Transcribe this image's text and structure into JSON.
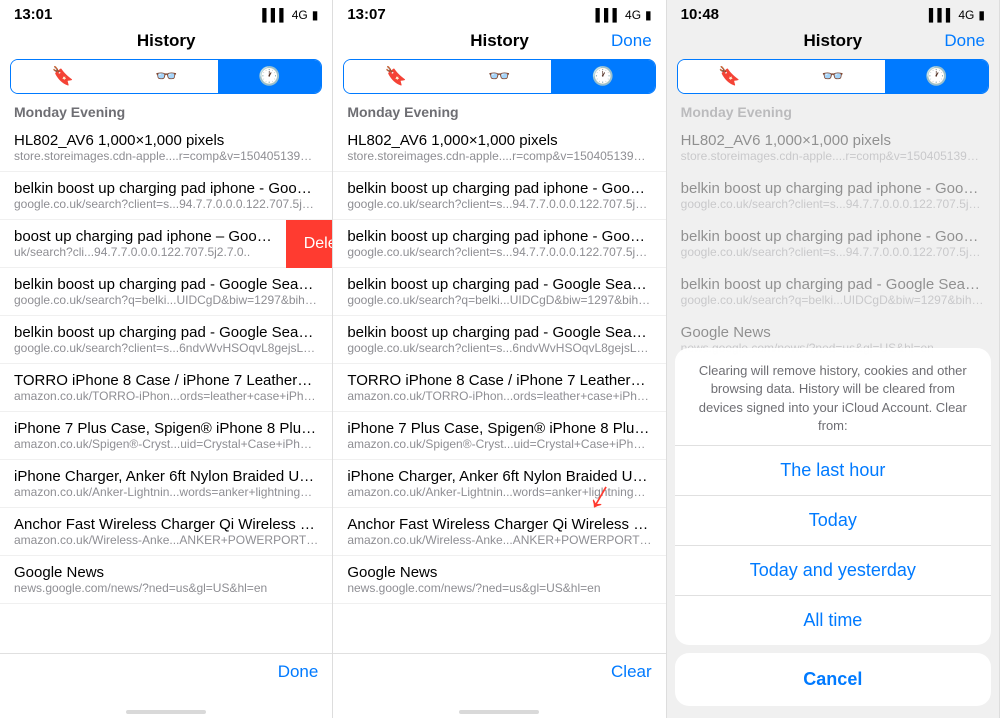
{
  "panel1": {
    "statusTime": "13:01",
    "statusSignal": "▌▌▌ 4G ▮",
    "title": "History",
    "doneLabel": "",
    "tabs": [
      {
        "icon": "🔖",
        "active": false
      },
      {
        "icon": "👓",
        "active": false
      },
      {
        "icon": "🕐",
        "active": true
      }
    ],
    "sectionHeader": "Monday Evening",
    "items": [
      {
        "title": "HL802_AV6 1,000×1,000 pixels",
        "url": "store.storeimages.cdn-apple....r=comp&v=1504051392224"
      },
      {
        "title": "belkin boost up charging pad iphone - Goo…",
        "url": "google.co.uk/search?client=s...94.7.7.0.0.0.122.707.5j2.7.0.."
      },
      {
        "title": "boost up charging pad iphone – Goo…",
        "url": "uk/search?cli...94.7.7.0.0.0.122.707.5j2.7.0.."
      },
      {
        "title": "belkin boost up charging pad - Google Sea…",
        "url": "google.co.uk/search?q=belki...UIDCgD&biw=1297&bih=1355"
      },
      {
        "title": "belkin boost up charging pad - Google Sea…",
        "url": "google.co.uk/search?client=s...6ndvWvHSOqvL8gejsL6oCQ"
      },
      {
        "title": "TORRO iPhone 8 Case / iPhone 7 Leather…",
        "url": "amazon.co.uk/TORRO-iPhon...ords=leather+case+iPhone+8"
      },
      {
        "title": "iPhone 7 Plus Case, Spigen® iPhone 8 Plus…",
        "url": "amazon.co.uk/Spigen®-Cryst...uid=Crystal+Case+iPhone+8"
      },
      {
        "title": "iPhone Charger, Anker 6ft Nylon Braided U…",
        "url": "amazon.co.uk/Anker-Lightnin...words=anker+lightning+cable"
      },
      {
        "title": "Anchor Fast Wireless Charger Qi Wireless I…",
        "url": "amazon.co.uk/Wireless-Anke...ANKER+POWERPORT+QI+10"
      },
      {
        "title": "Google News",
        "url": "news.google.com/news/?ned=us&gl=US&hl=en"
      }
    ],
    "swipeItemIndex": 2,
    "deleteLabel": "Delete",
    "bottomLabel": "Done"
  },
  "panel2": {
    "statusTime": "13:07",
    "statusSignal": "▌▌▌ 4G ▮",
    "title": "History",
    "doneLabel": "Done",
    "tabs": [
      {
        "icon": "🔖",
        "active": false
      },
      {
        "icon": "👓",
        "active": false
      },
      {
        "icon": "🕐",
        "active": true
      }
    ],
    "sectionHeader": "Monday Evening",
    "items": [
      {
        "title": "HL802_AV6 1,000×1,000 pixels",
        "url": "store.storeimages.cdn-apple....r=comp&v=1504051392224"
      },
      {
        "title": "belkin boost up charging pad iphone - Goo…",
        "url": "google.co.uk/search?client=s...94.7.7.0.0.0.122.707.5j2.7.0.."
      },
      {
        "title": "belkin boost up charging pad iphone - Goo…",
        "url": "google.co.uk/search?client=s...94.7.7.0.0.0.122.707.5j2.7.0.."
      },
      {
        "title": "belkin boost up charging pad - Google Sea…",
        "url": "google.co.uk/search?q=belki...UIDCgD&biw=1297&bih=1355"
      },
      {
        "title": "belkin boost up charging pad - Google Sea…",
        "url": "google.co.uk/search?client=s...6ndvWvHSOqvL8gejsL6oCQ"
      },
      {
        "title": "TORRO iPhone 8 Case / iPhone 7 Leather…",
        "url": "amazon.co.uk/TORRO-iPhon...ords=leather+case+iPhone+8"
      },
      {
        "title": "iPhone 7 Plus Case, Spigen® iPhone 8 Plus…",
        "url": "amazon.co.uk/Spigen®-Cryst...uid=Crystal+Case+iPhone+8"
      },
      {
        "title": "iPhone Charger, Anker 6ft Nylon Braided U…",
        "url": "amazon.co.uk/Anker-Lightnin...words=anker+lightning+cable"
      },
      {
        "title": "Anchor Fast Wireless Charger Qi Wireless I…",
        "url": "amazon.co.uk/Wireless-Anke...ANKER+POWERPORT+QI+10"
      },
      {
        "title": "Google News",
        "url": "news.google.com/news/?ned=us&gl=US&hl=en"
      }
    ],
    "bottomLabel": "Clear"
  },
  "panel3": {
    "statusTime": "10:48",
    "statusSignal": "▌▌▌ 4G ▮",
    "title": "History",
    "doneLabel": "Done",
    "tabs": [
      {
        "icon": "🔖",
        "active": false
      },
      {
        "icon": "👓",
        "active": false
      },
      {
        "icon": "🕐",
        "active": true
      }
    ],
    "sectionHeader": "Monday Evening",
    "items": [
      {
        "title": "HL802_AV6 1,000×1,000 pixels",
        "url": "store.storeimages.cdn-apple....r=comp&v=1504051392224"
      },
      {
        "title": "belkin boost up charging pad iphone - Goo…",
        "url": "google.co.uk/search?client=s...94.7.7.0.0.0.122.707.5j2.7.0.."
      },
      {
        "title": "belkin boost up charging pad iphone - Goo…",
        "url": "google.co.uk/search?client=s...94.7.7.0.0.0.122.707.5j2.7.0.."
      },
      {
        "title": "belkin boost up charging pad - Google Sea…",
        "url": "google.co.uk/search?q=belki...UIDCgD&biw=1297&bih=1355"
      },
      {
        "title": "Google News",
        "url": "news.google.com/news/?ned=us&gl=US&hl=en"
      }
    ],
    "actionSheet": {
      "description": "Clearing will remove history, cookies and other browsing data. History will be cleared from devices signed into your iCloud Account. Clear from:",
      "options": [
        "The last hour",
        "Today",
        "Today and yesterday",
        "All time"
      ],
      "cancelLabel": "Cancel"
    }
  }
}
